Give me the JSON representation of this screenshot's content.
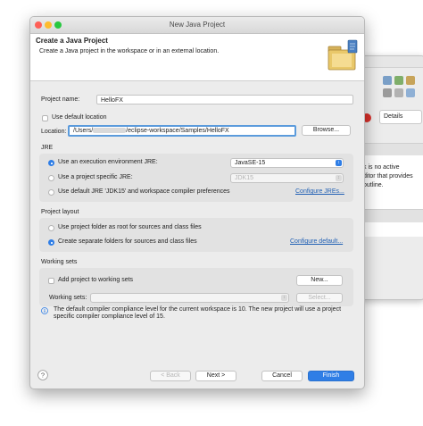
{
  "dialog": {
    "title": "New Java Project",
    "header_title": "Create a Java Project",
    "header_desc": "Create a Java project in the workspace or in an external location.",
    "icon": "java-project-folder-icon"
  },
  "project": {
    "name_label": "Project name:",
    "name_value": "HelloFX",
    "use_default_location_label": "Use default location",
    "location_label": "Location:",
    "location_prefix": "/Users/",
    "location_suffix": "/eclipse-workspace/Samples/HelloFX",
    "browse_label": "Browse..."
  },
  "jre": {
    "title": "JRE",
    "opt_env_label": "Use an execution environment JRE:",
    "opt_env_value": "JavaSE-15",
    "opt_specific_label": "Use a project specific JRE:",
    "opt_specific_value": "JDK15",
    "opt_default_label": "Use default JRE 'JDK15' and workspace compiler preferences",
    "configure_link": "Configure JREs..."
  },
  "layout": {
    "title": "Project layout",
    "opt_root_label": "Use project folder as root for sources and class files",
    "opt_separate_label": "Create separate folders for sources and class files",
    "configure_link": "Configure default..."
  },
  "working_sets": {
    "title": "Working sets",
    "add_label": "Add project to working sets",
    "new_label": "New...",
    "sets_label": "Working sets:",
    "select_label": "Select..."
  },
  "info": {
    "text": "The default compiler compliance level for the current workspace is 10. The new project will use a project specific compiler compliance level of 15."
  },
  "footer": {
    "back_label": "< Back",
    "next_label": "Next >",
    "cancel_label": "Cancel",
    "finish_label": "Finish"
  },
  "background_window": {
    "details_label": "Details",
    "text1": "k is no active",
    "text2": "ditor that provides",
    "text3": "outline."
  },
  "colors": {
    "accent": "#2f7ee6",
    "link": "#1f5fb4",
    "close": "#fe5f57",
    "minimize": "#febc2e",
    "maximize": "#28c840"
  }
}
